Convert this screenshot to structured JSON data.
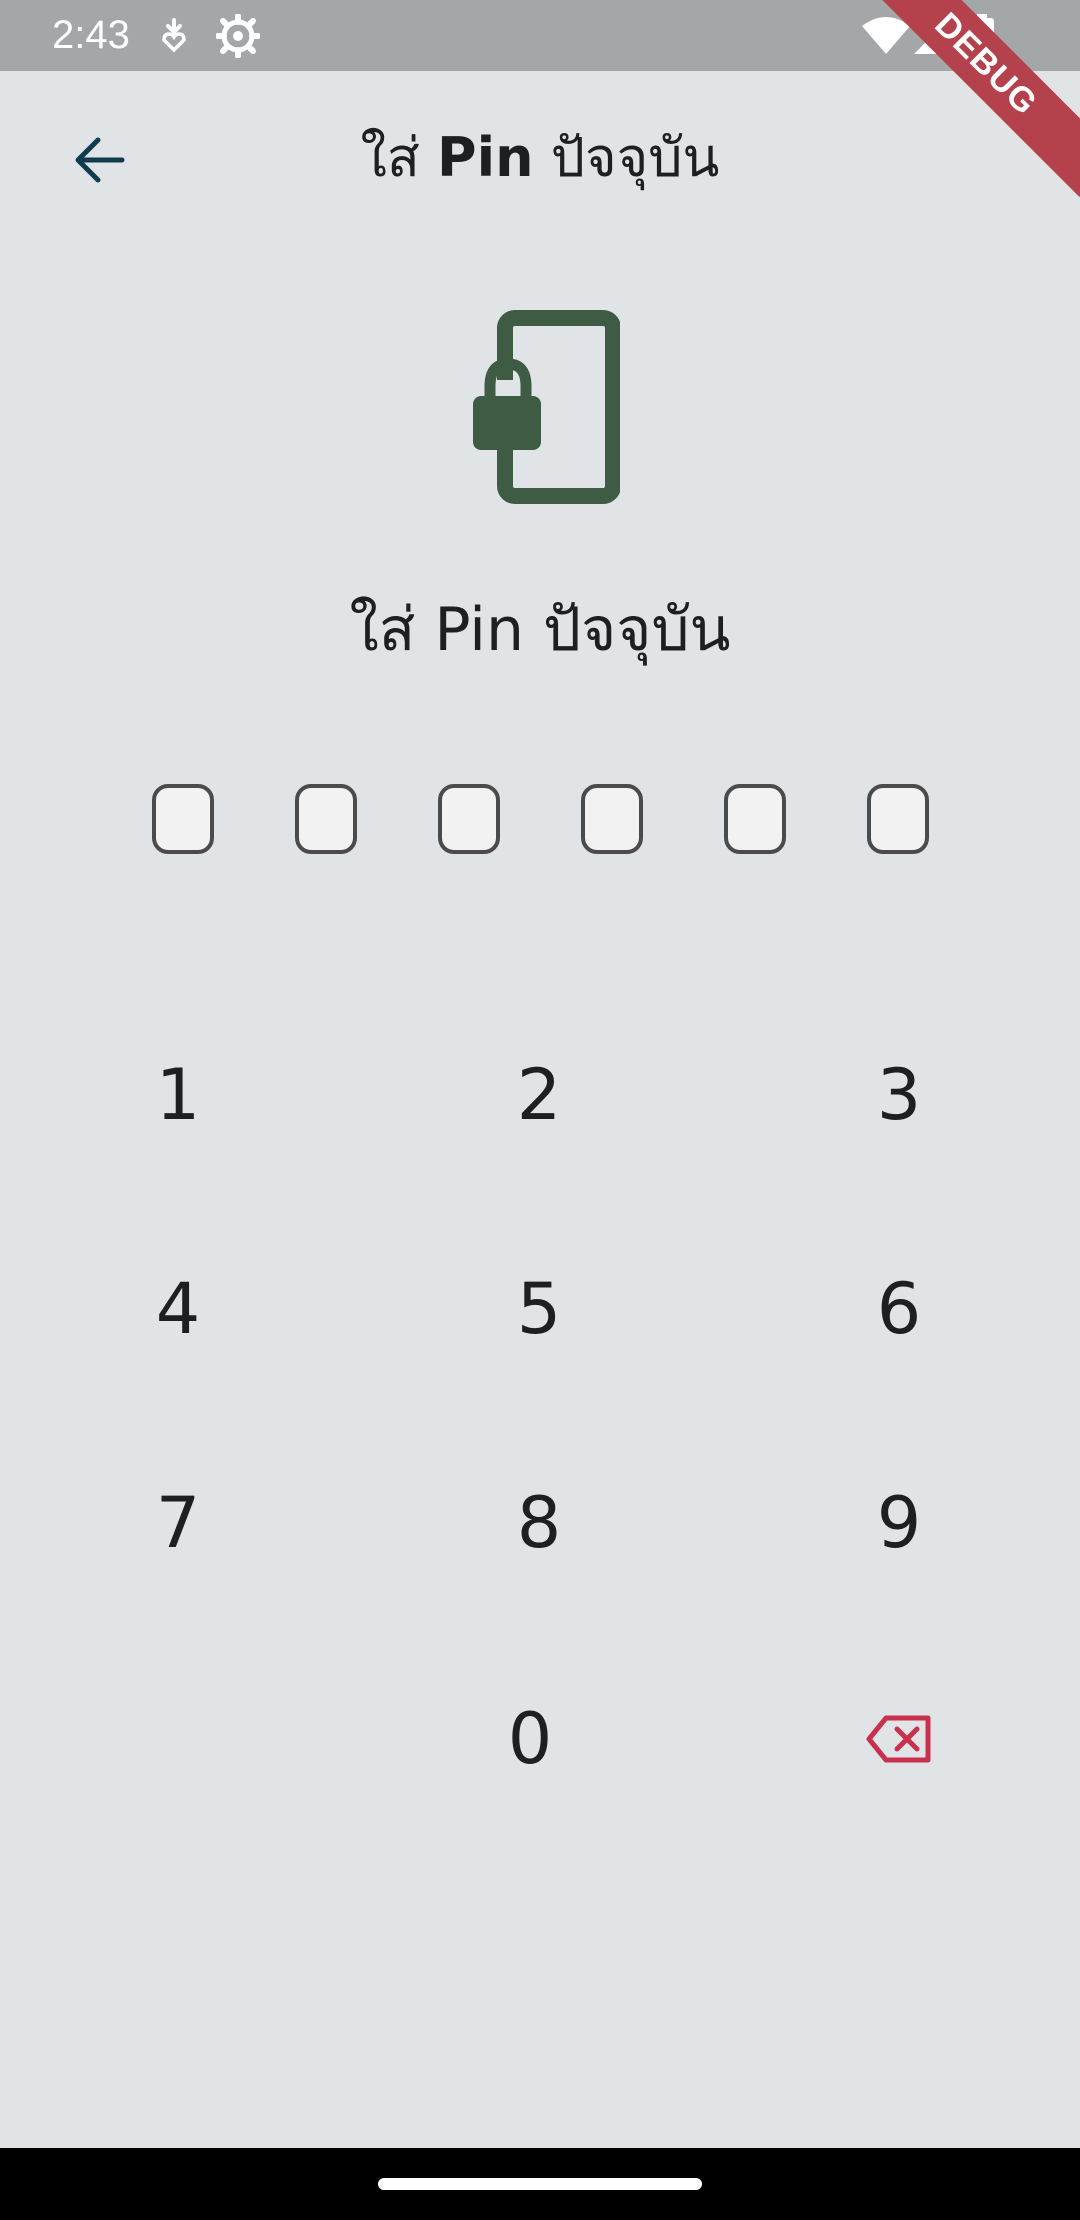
{
  "status_bar": {
    "time": "2:43"
  },
  "debug_banner": "DEBUG",
  "app_bar": {
    "title_prefix": "ใส่ ",
    "title_bold": "Pin",
    "title_suffix": " ปัจจุบัน"
  },
  "prompt": "ใส่ Pin ปัจจุบัน",
  "pin": {
    "length": 6,
    "entered": 0
  },
  "keypad": {
    "keys": [
      "1",
      "2",
      "3",
      "4",
      "5",
      "6",
      "7",
      "8",
      "9",
      "",
      "0",
      "⌫"
    ]
  },
  "colors": {
    "background": "#e1e4e6",
    "status_bar": "#a4a7a9",
    "icon_green": "#3e5c44",
    "back_arrow": "#0f3d4d",
    "delete_red": "#c8314e",
    "debug_ribbon": "#b4414b"
  },
  "icons": {
    "back": "arrow-left-icon",
    "illustration": "phone-lock-icon",
    "delete": "backspace-icon"
  }
}
